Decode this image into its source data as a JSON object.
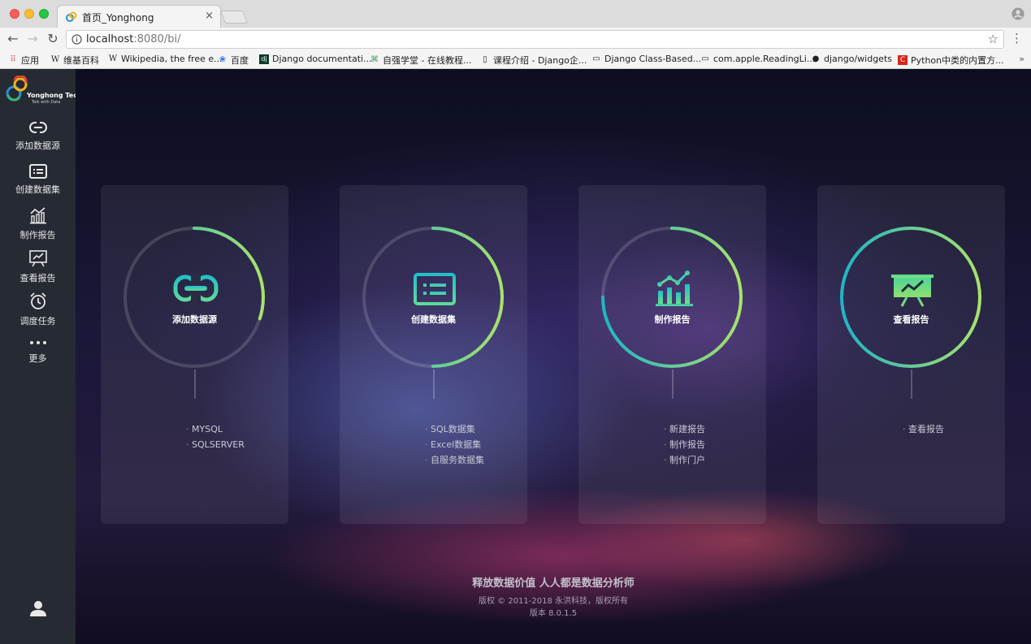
{
  "browser": {
    "tab_title": "首页_Yonghong",
    "tab_close": "×",
    "url_host": "localhost",
    "url_rest": ":8080/bi/",
    "bookmarks": [
      {
        "label": "应用",
        "icon": "apps-grid-icon"
      },
      {
        "label": "维基百科",
        "icon": "wikipedia-icon"
      },
      {
        "label": "Wikipedia, the free e...",
        "icon": "wikipedia-icon"
      },
      {
        "label": "百度",
        "icon": "baidu-paw-icon"
      },
      {
        "label": "Django documentati...",
        "icon": "django-icon"
      },
      {
        "label": "自强学堂 - 在线教程...",
        "icon": "site-icon"
      },
      {
        "label": "课程介绍 - Django企...",
        "icon": "book-icon"
      },
      {
        "label": "Django Class-Based...",
        "icon": "page-icon"
      },
      {
        "label": "com.apple.ReadingLi...",
        "icon": "folder-icon"
      },
      {
        "label": "django/widgets",
        "icon": "github-icon"
      },
      {
        "label": "Python中类的内置方...",
        "icon": "csdn-icon"
      }
    ],
    "bookmarks_more": "»"
  },
  "sidebar": {
    "logo_name": "Yonghong Tech",
    "logo_tagline": "Talk with Data",
    "items": [
      {
        "label": "添加数据源",
        "icon": "link-icon"
      },
      {
        "label": "创建数据集",
        "icon": "dataset-list-icon"
      },
      {
        "label": "制作报告",
        "icon": "bar-chart-icon"
      },
      {
        "label": "查看报告",
        "icon": "presentation-icon"
      },
      {
        "label": "调度任务",
        "icon": "alarm-clock-icon"
      },
      {
        "label": "更多",
        "icon": "more-dots-icon"
      }
    ]
  },
  "cards": [
    {
      "title": "添加数据源",
      "icon": "link-icon",
      "progress": 0.3,
      "items": [
        "MYSQL",
        "SQLSERVER"
      ]
    },
    {
      "title": "创建数据集",
      "icon": "dataset-list-icon",
      "progress": 0.5,
      "items": [
        "SQL数据集",
        "Excel数据集",
        "自服务数据集"
      ]
    },
    {
      "title": "制作报告",
      "icon": "bar-chart-icon",
      "progress": 0.75,
      "items": [
        "新建报告",
        "制作报告",
        "制作门户"
      ]
    },
    {
      "title": "查看报告",
      "icon": "presentation-icon",
      "progress": 1.0,
      "items": [
        "查看报告"
      ]
    }
  ],
  "footer": {
    "slogan": "释放数据价值 人人都是数据分析师",
    "copyright": "版权 © 2011-2018 永洪科技，版权所有",
    "version": "版本 8.0.1.5"
  },
  "colors": {
    "sidebar_bg": "#262a33",
    "ring_start": "#1fb5c4",
    "ring_end": "#a6e36b",
    "accent": "#2bc6b4"
  }
}
